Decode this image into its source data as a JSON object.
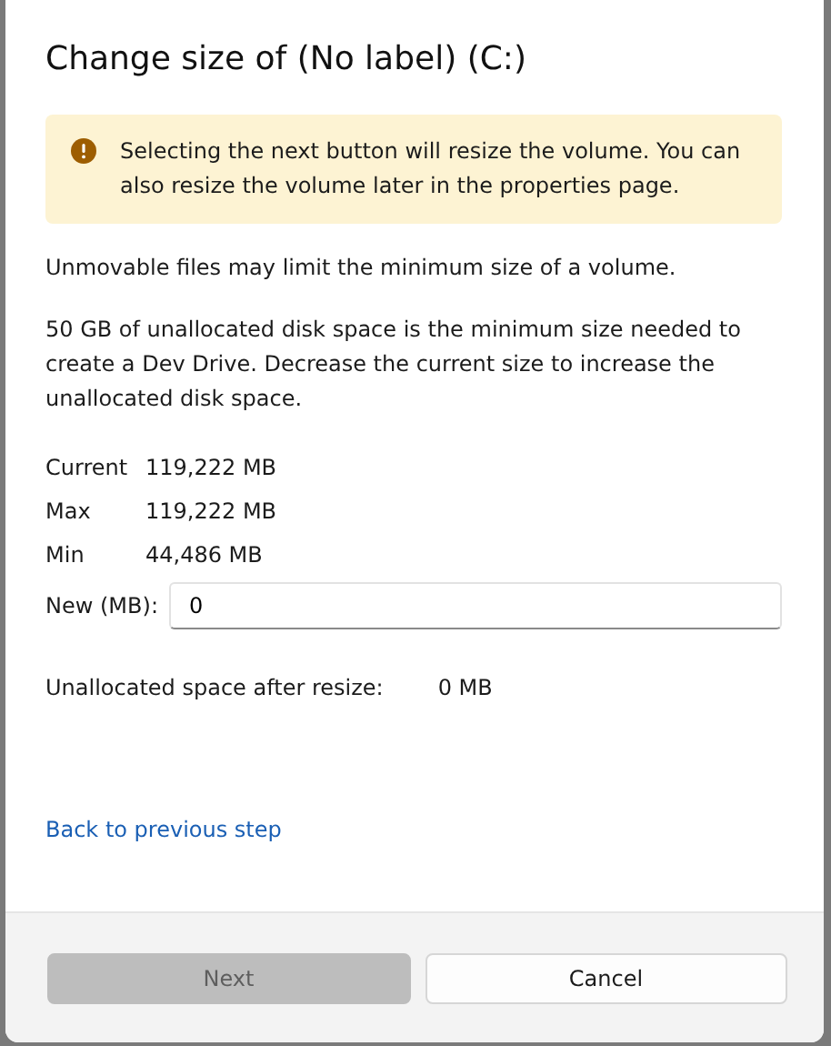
{
  "dialog": {
    "title": "Change size of (No label) (C:)",
    "warning": {
      "text": "Selecting the next button will resize the volume. You can also resize the volume later in the properties page."
    },
    "notes": [
      "Unmovable files may limit the minimum size of a volume.",
      "50 GB of unallocated disk space is the minimum size needed to create a Dev Drive. Decrease the current size to increase the unallocated disk space."
    ],
    "sizes": [
      {
        "label": "Current",
        "value": "119,222 MB"
      },
      {
        "label": "Max",
        "value": "119,222 MB"
      },
      {
        "label": "Min",
        "value": " 44,486 MB"
      }
    ],
    "new_size": {
      "label": "New (MB):",
      "value": "0"
    },
    "unallocated": {
      "label": "Unallocated space after resize:",
      "value": "0 MB"
    },
    "back_link": "Back to previous step",
    "buttons": [
      {
        "label": "Next",
        "disabled": true
      },
      {
        "label": "Cancel",
        "disabled": false
      }
    ]
  }
}
